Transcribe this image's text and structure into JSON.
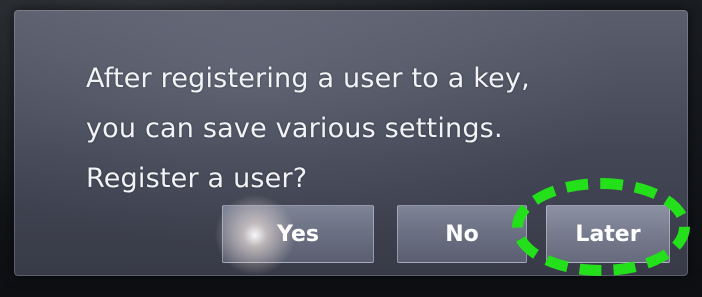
{
  "dialog": {
    "message_lines": [
      "After registering a user to a key,",
      "you can save various settings.",
      "Register a user?"
    ],
    "buttons": {
      "yes": "Yes",
      "no": "No",
      "later": "Later"
    }
  },
  "annotation": {
    "highlight_color": "#23e01a",
    "highlighted": "later-button"
  }
}
